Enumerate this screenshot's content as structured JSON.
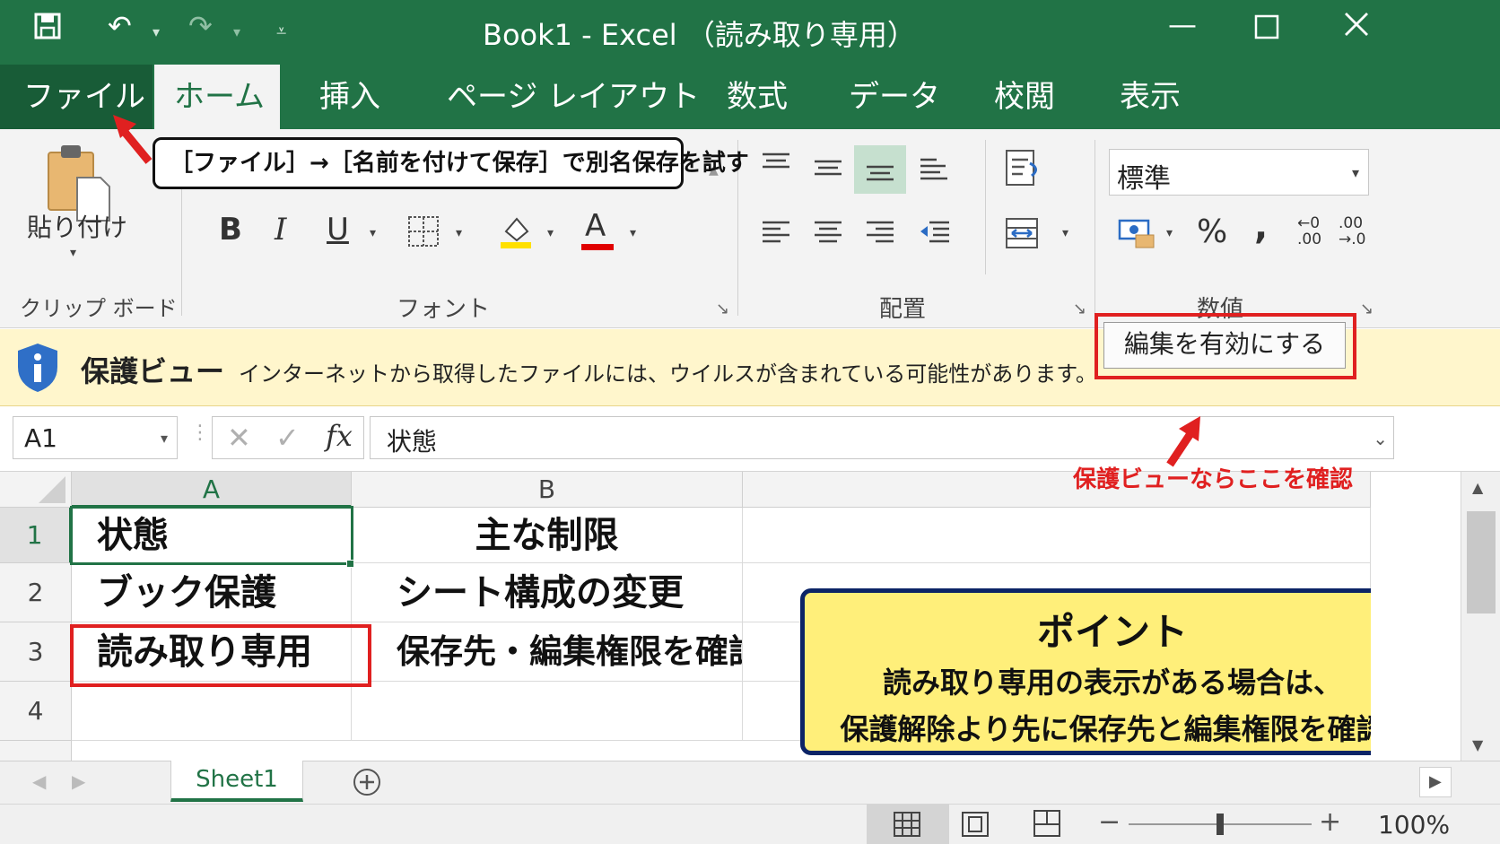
{
  "window": {
    "title": "Book1 - Excel （読み取り専用）"
  },
  "tabs": [
    "ファイル",
    "ホーム",
    "挿入",
    "ページ レイアウト",
    "数式",
    "データ",
    "校閲",
    "表示"
  ],
  "ribbon": {
    "clipboard": {
      "paste_label": "貼り付け",
      "group_label": "クリップ ボード"
    },
    "font": {
      "bold": "B",
      "italic": "I",
      "underline": "U",
      "font_color": "A",
      "group_label": "フォント"
    },
    "alignment": {
      "group_label": "配置"
    },
    "number": {
      "format_value": "標準",
      "percent": "%",
      "comma": ",",
      "inc_decimal_top": "←0",
      "inc_decimal_bottom": ".00",
      "dec_decimal_top": ".00",
      "dec_decimal_bottom": "→.0",
      "group_label": "数値"
    }
  },
  "callouts": {
    "file_tip": "［ファイル］→［名前を付けて保存］で別名保存を試す",
    "pv_tip": "保護ビューならここを確認"
  },
  "protected_view": {
    "title": "保護ビュー",
    "message": "インターネットから取得したファイルには、ウイルスが含まれている可能性があります。",
    "button": "編集を有効にする"
  },
  "formula_bar": {
    "name_box": "A1",
    "fx": "fx",
    "content": "状態"
  },
  "grid": {
    "columns": [
      "A",
      "B"
    ],
    "rows": [
      "1",
      "2",
      "3",
      "4"
    ],
    "cells": [
      [
        "状態",
        "主な制限"
      ],
      [
        "ブック保護",
        "シート構成の変更"
      ],
      [
        "読み取り専用",
        "保存先・編集権限を確認"
      ],
      [
        "",
        ""
      ]
    ]
  },
  "point_box": {
    "title": "ポイント",
    "line1": "読み取り専用の表示がある場合は、",
    "line2": "保護解除より先に保存先と編集権限を確認"
  },
  "sheets": {
    "active": "Sheet1"
  },
  "status": {
    "zoom": "100%",
    "zoom_level": 0.5
  },
  "colors": {
    "excel_green": "#217346",
    "highlight_red": "#e02020",
    "pv_yellow": "#fff6cc",
    "point_yellow": "#ffef7a",
    "point_border": "#0c2466"
  }
}
